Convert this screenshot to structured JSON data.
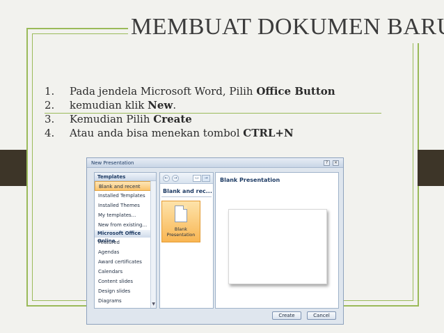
{
  "slide": {
    "title": "MEMBUAT DOKUMEN BARU",
    "steps": [
      {
        "num": "1.",
        "text": "Pada jendela Microsoft Word,  Pilih ",
        "bold": "Office Button",
        "after": ""
      },
      {
        "num": "2.",
        "text": "kemudian klik ",
        "bold": "New",
        "after": "."
      },
      {
        "num": "3.",
        "text": "Kemudian   Pilih ",
        "bold": "Create",
        "after": ""
      },
      {
        "num": "4.",
        "text": "Atau anda bisa menekan tombol ",
        "bold": "CTRL+N",
        "after": ""
      }
    ],
    "accent_color": "#9aba59"
  },
  "dialog": {
    "title": "New Presentation",
    "window_controls": [
      "?",
      "×"
    ],
    "left_panel": {
      "header": "Templates",
      "items": [
        {
          "label": "Blank and recent",
          "selected": true
        },
        {
          "label": "Installed Templates"
        },
        {
          "label": "Installed Themes"
        },
        {
          "label": "My templates..."
        },
        {
          "label": "New from existing..."
        }
      ],
      "section": "Microsoft Office Online",
      "online_items": [
        "Featured",
        "Agendas",
        "Award certificates",
        "Calendars",
        "Content slides",
        "Design slides",
        "Diagrams"
      ]
    },
    "middle_panel": {
      "heading": "Blank and rec...",
      "tile_label": "Blank Presentation"
    },
    "right_panel": {
      "title": "Blank Presentation"
    },
    "buttons": {
      "create": "Create",
      "cancel": "Cancel"
    }
  }
}
